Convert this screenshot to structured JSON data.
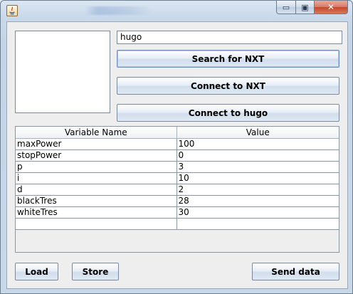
{
  "window": {
    "app_icon": "java-icon",
    "controls": {
      "minimize": "▭",
      "maximize": "▣",
      "close": "✕"
    }
  },
  "form": {
    "robot_name_value": "hugo",
    "search_button": "Search for NXT",
    "connect_button": "Connect to NXT",
    "connect_named_button": "Connect to hugo"
  },
  "table": {
    "columns": [
      "Variable Name",
      "Value"
    ],
    "rows": [
      {
        "name": "maxPower",
        "value": "100"
      },
      {
        "name": "stopPower",
        "value": "0"
      },
      {
        "name": "p",
        "value": "3"
      },
      {
        "name": "i",
        "value": "10"
      },
      {
        "name": "d",
        "value": "2"
      },
      {
        "name": "blackTres",
        "value": "28"
      },
      {
        "name": "whiteTres",
        "value": "30"
      },
      {
        "name": "",
        "value": ""
      }
    ]
  },
  "footer": {
    "load_button": "Load",
    "store_button": "Store",
    "send_button": "Send data"
  }
}
